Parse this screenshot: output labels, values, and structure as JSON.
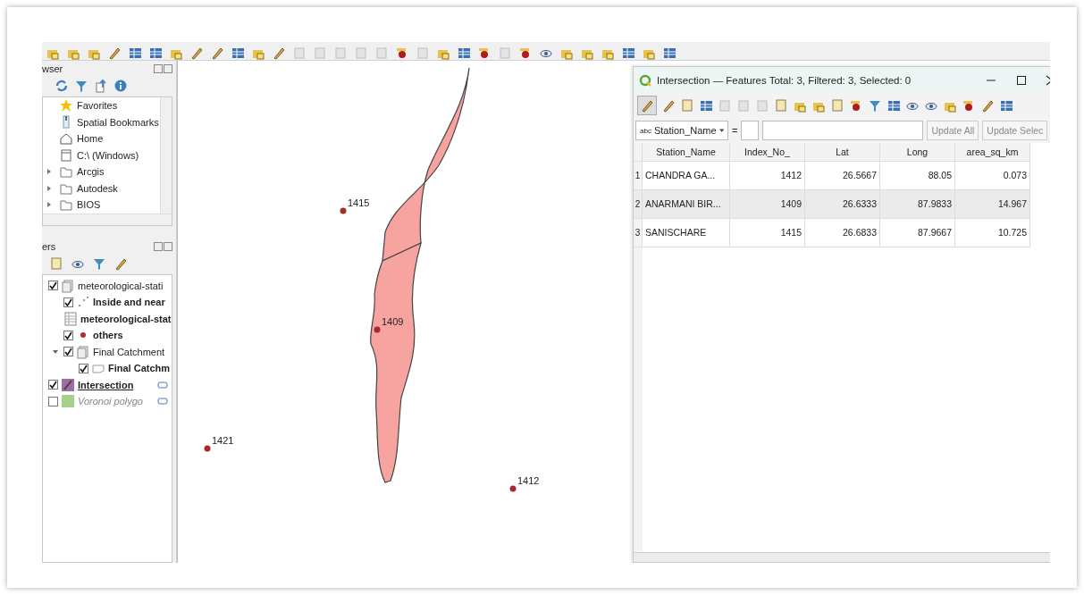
{
  "browser_panel": {
    "title": "wser",
    "items": [
      {
        "label": "Favorites",
        "kind": "favorites"
      },
      {
        "label": "Spatial Bookmarks",
        "kind": "bookmarks"
      },
      {
        "label": "Home",
        "kind": "home"
      },
      {
        "label": "C:\\ (Windows)",
        "kind": "drive"
      },
      {
        "label": "Arcgis",
        "kind": "folder"
      },
      {
        "label": "Autodesk",
        "kind": "folder"
      },
      {
        "label": "BIOS",
        "kind": "folder"
      }
    ]
  },
  "layers_panel": {
    "title": "ers",
    "layers": [
      {
        "label": "meteorological-stati",
        "kind": "group",
        "checked": true,
        "selected": false,
        "badge": false,
        "children": [
          {
            "label": "Inside and near",
            "kind": "points",
            "checked": true,
            "selected": false,
            "badge": false
          },
          {
            "label": "meteorological-stat",
            "kind": "table",
            "selected": false,
            "badge": false
          },
          {
            "label": "others",
            "kind": "dot",
            "color": "#a83232",
            "checked": true,
            "selected": false,
            "badge": false
          },
          {
            "label": "Final Catchment",
            "kind": "group",
            "checked": true,
            "expanded": true,
            "selected": false,
            "badge": false,
            "children": [
              {
                "label": "Final Catchm",
                "kind": "outline",
                "checked": true,
                "selected": false,
                "badge": false
              }
            ]
          }
        ]
      },
      {
        "label": "Intersection",
        "kind": "edit-fill",
        "color": "#9a6fa8",
        "checked": true,
        "selected": true,
        "badge": true
      },
      {
        "label": "Voronoi polygo",
        "kind": "fill",
        "color": "#a8d08d",
        "checked": false,
        "selected": false,
        "badge": true
      }
    ]
  },
  "map": {
    "stations": [
      {
        "label": "1415"
      },
      {
        "label": "1409"
      },
      {
        "label": "1421"
      },
      {
        "label": "1412"
      }
    ]
  },
  "attribute_table": {
    "title": "Intersection — Features Total: 3, Filtered: 3, Selected: 0",
    "field": {
      "tag": "abc",
      "value": "Station_Name"
    },
    "operator": "=",
    "buttons": [
      "Update All",
      "Update Selec"
    ],
    "columns": [
      "Station_Name",
      "Index_No_",
      "Lat",
      "Long",
      "area_sq_km"
    ],
    "rows": [
      {
        "number": "1",
        "cells": [
          "CHANDRA GA...",
          "1412",
          "26.5667",
          "88.05",
          "0.073"
        ]
      },
      {
        "number": "2",
        "cells": [
          "ANARMANI BIR...",
          "1409",
          "26.6333",
          "87.9833",
          "14.967"
        ]
      },
      {
        "number": "3",
        "cells": [
          "SANISCHARE",
          "1415",
          "26.6833",
          "87.9667",
          "10.725"
        ]
      }
    ]
  }
}
